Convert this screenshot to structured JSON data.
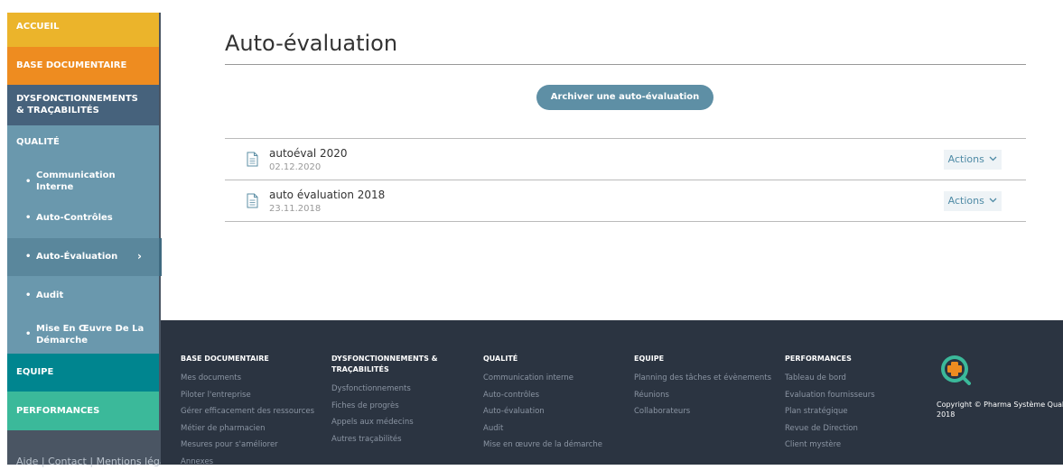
{
  "sidebar": {
    "accueil": "ACCUEIL",
    "base_documentaire": "BASE DOCUMENTAIRE",
    "dysfonctionnements_line1": "DYSFONCTIONNEMENTS",
    "dysfonctionnements_line2": "& TRAÇABILITÉS",
    "qualite": "QUALITÉ",
    "sub_items": {
      "communication_line1": "Communication",
      "communication_line2": "Interne",
      "auto_controles": "Auto-Contrôles",
      "auto_evaluation": "Auto-Évaluation",
      "audit": "Audit",
      "mise_line1": "Mise En Œuvre De La",
      "mise_line2": "Démarche"
    },
    "equipe": "EQUIPE",
    "performances": "PERFORMANCES",
    "bottom_links": {
      "aide": "Aide",
      "contact": "Contact",
      "mentions": "Mentions légales",
      "separator": "|"
    }
  },
  "main": {
    "title": "Auto-évaluation",
    "archive_button": "Archiver une auto-évaluation",
    "documents": [
      {
        "name": "autoéval 2020",
        "date": "02.12.2020",
        "actions_label": "Actions"
      },
      {
        "name": "auto évaluation 2018",
        "date": "23.11.2018",
        "actions_label": "Actions"
      }
    ]
  },
  "footer": {
    "columns": [
      {
        "heading": "BASE DOCUMENTAIRE",
        "links": [
          "Mes documents",
          "Piloter l'entreprise",
          "Gérer efficacement des ressources",
          "Métier de pharmacien",
          "Mesures pour s'améliorer",
          "Annexes"
        ]
      },
      {
        "heading_line1": "DYSFONCTIONNEMENTS &",
        "heading_line2": "TRAÇABILITÉS",
        "links": [
          "Dysfonctionnements",
          "Fiches de progrès",
          "Appels aux médecins",
          "Autres traçabilités"
        ]
      },
      {
        "heading": "QUALITÉ",
        "links": [
          "Communication interne",
          "Auto-contrôles",
          "Auto-évaluation",
          "Audit",
          "Mise en œuvre de la démarche"
        ]
      },
      {
        "heading": "EQUIPE",
        "links": [
          "Planning des tâches et évènements",
          "Réunions",
          "Collaborateurs"
        ]
      },
      {
        "heading": "PERFORMANCES",
        "links": [
          "Tableau de bord",
          "Evaluation fournisseurs",
          "Plan stratégique",
          "Revue de Direction",
          "Client mystère"
        ]
      }
    ],
    "copyright_line1": "Copyright © Pharma Système Qualité",
    "copyright_line2": "2018"
  },
  "colors": {
    "accueil": "#ebb42b",
    "base_documentaire": "#ee8c20",
    "dysfonctionnements": "#46627c",
    "qualite": "#6a98ad",
    "equipe": "#00858f",
    "performances": "#3bb99a",
    "footer_bg": "#2b3441",
    "button": "#5e8fa5"
  },
  "icons": {
    "document": "document-icon",
    "chevron": "chevron-down-icon",
    "submenu_arrow": "chevron-right-icon",
    "logo": "pharma-systeme-qualite-logo"
  }
}
